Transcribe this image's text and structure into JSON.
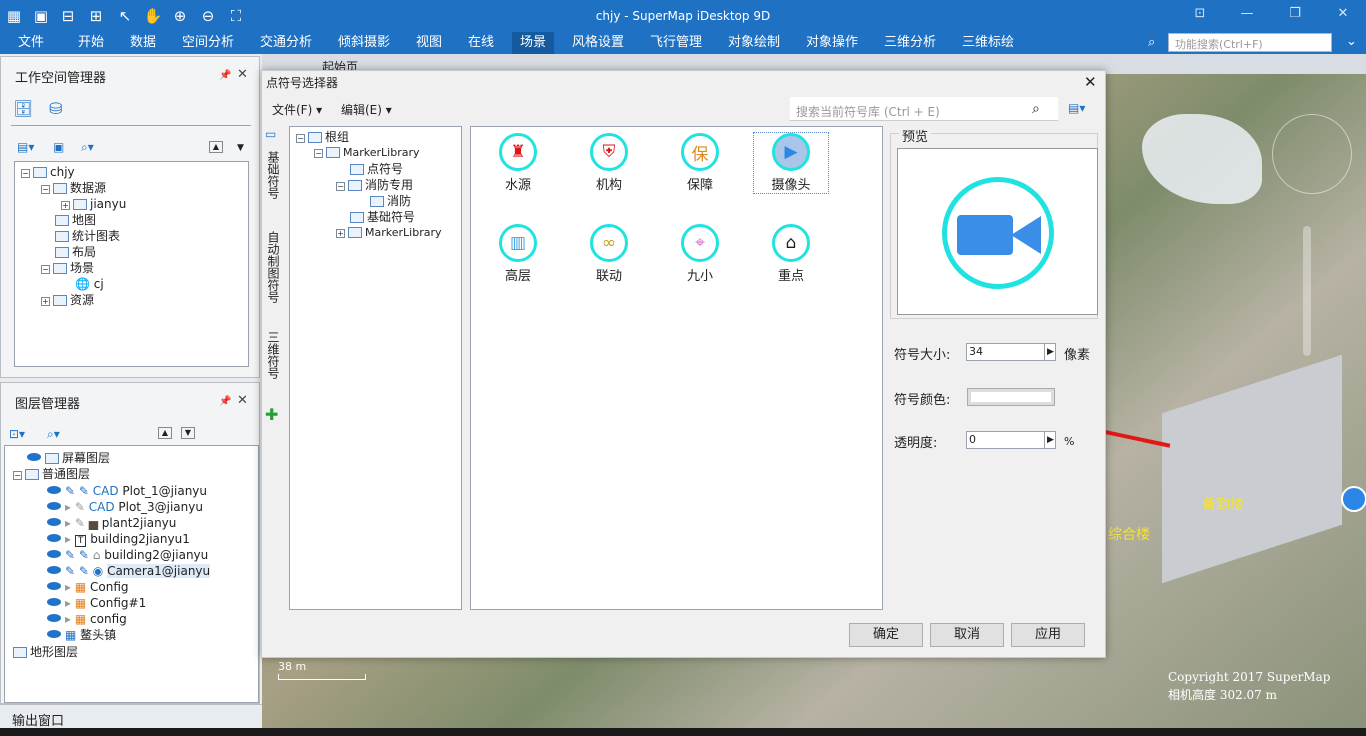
{
  "window": {
    "title": "chjy - SuperMap iDesktop 9D"
  },
  "menu": {
    "items": [
      "文件",
      "开始",
      "数据",
      "空间分析",
      "交通分析",
      "倾斜摄影",
      "视图",
      "在线",
      "场景",
      "风格设置",
      "飞行管理",
      "对象绘制",
      "对象操作",
      "三维分析",
      "三维标绘"
    ],
    "selected": "场景",
    "search_placeholder": "功能搜索(Ctrl+F)"
  },
  "workspace": {
    "title": "工作空间管理器",
    "root": "chjy",
    "nodes": [
      "数据源",
      "jianyu",
      "地图",
      "统计图表",
      "布局",
      "场景",
      "cj",
      "资源"
    ]
  },
  "layers": {
    "title": "图层管理器",
    "nodes": [
      "屏幕图层",
      "普通图层",
      "Plot_1@jianyu",
      "Plot_3@jianyu",
      "plant2jianyu",
      "building2jianyu1",
      "building2@jianyu",
      "Camera1@jianyu",
      "Config",
      "Config#1",
      "config",
      "鳌头镇",
      "地形图层"
    ]
  },
  "output": {
    "title": "输出窗口"
  },
  "map_tab": {
    "label": "起始页"
  },
  "map": {
    "scale": "38 m",
    "copyright": "Copyright 2017 SuperMap",
    "altitude": "相机高度 302.07 m",
    "labels": [
      "备勤楼",
      "综合楼"
    ]
  },
  "dialog": {
    "title": "点符号选择器",
    "menu_file": "文件(F)",
    "menu_edit": "编辑(E)",
    "search_placeholder": "搜索当前符号库 (Ctrl + E)",
    "side_tabs": [
      "基础符号",
      "自动制图符号",
      "三维符号"
    ],
    "tree": [
      "根组",
      "MarkerLibrary",
      "点符号",
      "消防专用",
      "消防",
      "基础符号",
      "MarkerLibrary"
    ],
    "symbols": [
      {
        "label": "水源",
        "icon": "hydrant-icon",
        "glyph": "♜",
        "color": "#e2141a"
      },
      {
        "label": "机构",
        "icon": "shield-icon",
        "glyph": "⛨",
        "color": "#d6141a"
      },
      {
        "label": "保障",
        "icon": "bao-icon",
        "glyph": "保",
        "color": "#e08a1c"
      },
      {
        "label": "摄像头",
        "icon": "camera-icon",
        "glyph": "▶",
        "color": "#2b86e6"
      },
      {
        "label": "高层",
        "icon": "building-icon",
        "glyph": "▥",
        "color": "#3aa0e6"
      },
      {
        "label": "联动",
        "icon": "link-icon",
        "glyph": "∞",
        "color": "#c9a11b"
      },
      {
        "label": "九小",
        "icon": "location-icon",
        "glyph": "⌖",
        "color": "#d46fd0"
      },
      {
        "label": "重点",
        "icon": "home-icon",
        "glyph": "⌂",
        "color": "#222222"
      }
    ],
    "selected_symbol": "摄像头",
    "preview_label": "预览",
    "size_label": "符号大小:",
    "size_value": "34",
    "size_unit": "像素",
    "color_label": "符号颜色:",
    "opacity_label": "透明度:",
    "opacity_value": "0",
    "opacity_unit": "%",
    "ok": "确定",
    "cancel": "取消",
    "apply": "应用"
  },
  "colors": {
    "brand": "#1f71c4",
    "accent_cyan": "#20e2e0",
    "camera_blue": "#3a8ee8"
  }
}
